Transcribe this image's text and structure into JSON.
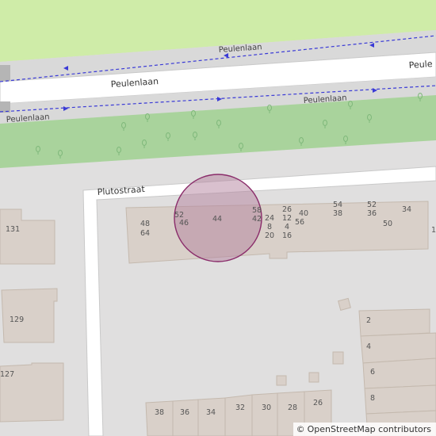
{
  "map": {
    "colors": {
      "background": "#e0dfdf",
      "park": "#cfeca8",
      "grass": "#a9d39c",
      "road": "#ffffff",
      "road_casing": "#c9c9c9",
      "building": "#d9d0c9",
      "building_outline": "#c4b9ae",
      "path": "#3a3ad6",
      "marker_fill": "#b4829e",
      "marker_stroke": "#8a2c6a"
    },
    "streets": {
      "peulenlaan_main": "Peulenlaan",
      "peulenlaan_main_right": "Peule",
      "peulenlaan_path_top": "Peulenlaan",
      "peulenlaan_path_bottom_right": "Peulenlaan",
      "peulenlaan_path_bottom_left": "Peulenlaan",
      "plutostraat": "Plutostraat"
    },
    "house_numbers": {
      "n131": "131",
      "n129": "129",
      "n127": "127",
      "n48": "48",
      "n64": "64",
      "n52a": "52",
      "n46": "46",
      "n44": "44",
      "n58": "58",
      "n42": "42",
      "n24": "24",
      "n8": "8",
      "n20": "20",
      "n26a": "26",
      "n12": "12",
      "n4": "4",
      "n16": "16",
      "n40": "40",
      "n56": "56",
      "n54": "54",
      "n38a": "38",
      "n52b": "52",
      "n36a": "36",
      "n50": "50",
      "n34a": "34",
      "n1": "1",
      "n2": "2",
      "n4b": "4",
      "n6": "6",
      "n8b": "8",
      "r38": "38",
      "r36": "36",
      "r34": "34",
      "r32": "32",
      "r30": "30",
      "r28": "28",
      "r26": "26"
    },
    "marker": {
      "label": "44"
    }
  },
  "attribution": {
    "icon": "copyright-icon",
    "symbol": "©",
    "text": "OpenStreetMap contributors"
  }
}
